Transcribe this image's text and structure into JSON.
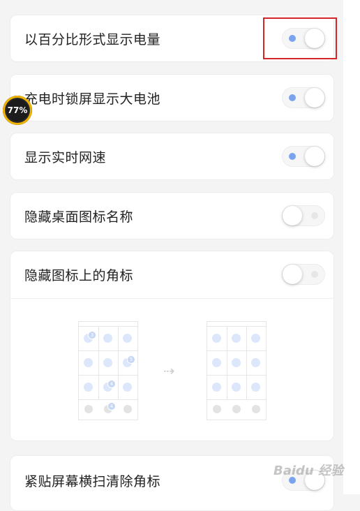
{
  "settings": {
    "percent_battery": {
      "label": "以百分比形式显示电量",
      "on": true
    },
    "lockscreen_battery": {
      "label": "充电时锁屏显示大电池",
      "on": true
    },
    "network_speed": {
      "label": "显示实时网速",
      "on": true
    },
    "hide_icon_names": {
      "label": "隐藏桌面图标名称",
      "on": false
    },
    "hide_badges": {
      "label": "隐藏图标上的角标",
      "on": false
    },
    "swipe_clear_badges": {
      "label": "紧贴屏幕横扫清除角标",
      "on": true
    }
  },
  "illustration": {
    "badge_before": [
      "3",
      "5",
      "4",
      "4"
    ]
  },
  "overlay": {
    "battery_percent": "77%"
  },
  "watermark": "Baidu 经验"
}
